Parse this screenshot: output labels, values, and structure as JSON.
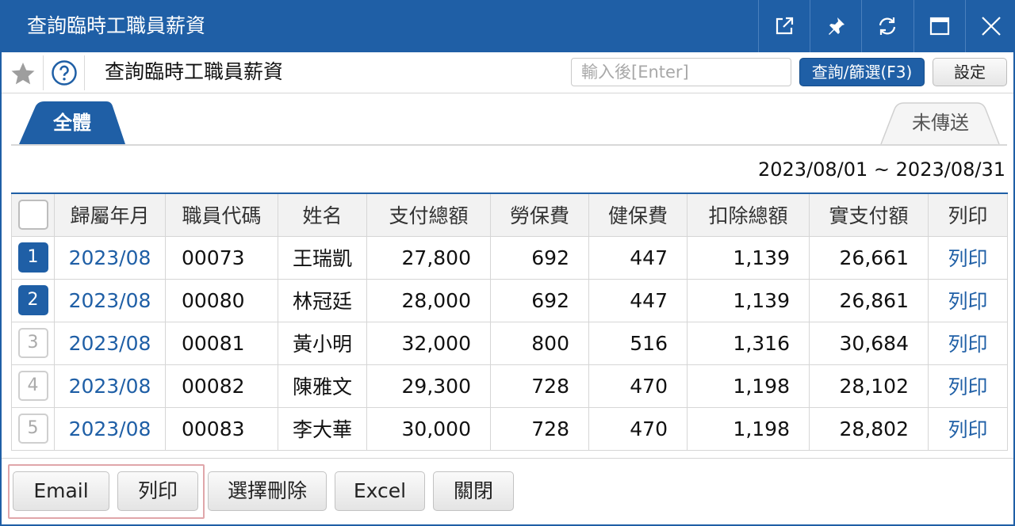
{
  "window": {
    "title": "查詢臨時工職員薪資",
    "controls": [
      "external-link-icon",
      "pin-icon",
      "refresh-icon",
      "maximize-icon",
      "close-icon"
    ]
  },
  "toolbar": {
    "page_title": "查詢臨時工職員薪資",
    "search_placeholder": "輸入後[Enter]",
    "search_value": "",
    "query_label": "查詢/篩選(F3)",
    "settings_label": "設定"
  },
  "tabs": [
    {
      "label": "全體",
      "active": true
    },
    {
      "label": "未傳送",
      "active": false
    }
  ],
  "date_range": "2023/08/01 ~ 2023/08/31",
  "table": {
    "headers": [
      "歸屬年月",
      "職員代碼",
      "姓名",
      "支付總額",
      "勞保費",
      "健保費",
      "扣除總額",
      "實支付額",
      "列印"
    ],
    "rows": [
      {
        "no": "1",
        "selected": true,
        "period": "2023/08",
        "code": "00073",
        "name": "王瑞凱",
        "gross": "27,800",
        "labor": "692",
        "health": "447",
        "deduct": "1,139",
        "net": "26,661",
        "print": "列印"
      },
      {
        "no": "2",
        "selected": true,
        "period": "2023/08",
        "code": "00080",
        "name": "林冠廷",
        "gross": "28,000",
        "labor": "692",
        "health": "447",
        "deduct": "1,139",
        "net": "26,861",
        "print": "列印"
      },
      {
        "no": "3",
        "selected": false,
        "period": "2023/08",
        "code": "00081",
        "name": "黃小明",
        "gross": "32,000",
        "labor": "800",
        "health": "516",
        "deduct": "1,316",
        "net": "30,684",
        "print": "列印"
      },
      {
        "no": "4",
        "selected": false,
        "period": "2023/08",
        "code": "00082",
        "name": "陳雅文",
        "gross": "29,300",
        "labor": "728",
        "health": "470",
        "deduct": "1,198",
        "net": "28,102",
        "print": "列印"
      },
      {
        "no": "5",
        "selected": false,
        "period": "2023/08",
        "code": "00083",
        "name": "李大華",
        "gross": "30,000",
        "labor": "728",
        "health": "470",
        "deduct": "1,198",
        "net": "28,802",
        "print": "列印"
      }
    ]
  },
  "footer": {
    "email_label": "Email",
    "print_label": "列印",
    "delete_selected_label": "選擇刪除",
    "excel_label": "Excel",
    "close_label": "關閉"
  },
  "colors": {
    "accent": "#1f5fa6",
    "highlight_border": "#e0a6aa"
  }
}
